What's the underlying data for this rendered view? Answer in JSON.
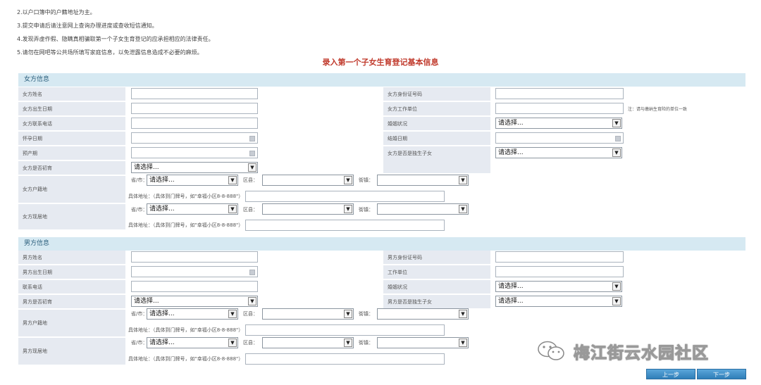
{
  "notes": [
    "2.以户口簿中的户籍地址为主。",
    "3.提交申请后请注意网上查询办理进度或查收短信通知。",
    "4.发现弄虚作假、隐瞒真相骗取第一个子女生育登记的应承担相应的法律责任。",
    "5.请勿在网吧等公共场所填写家庭信息，以免泄露信息造成不必要的麻烦。"
  ],
  "page_title": "录入第一个子女生育登记基本信息",
  "female": {
    "header": "女方信息",
    "name_label": "女方姓名",
    "id_label": "女方身份证号码",
    "birth_label": "女方出生日期",
    "work_label": "女方工作单位",
    "work_hint": "注：请与缴纳生育险的单位一致",
    "phone_label": "女方联系电话",
    "marital_label": "婚姻状况",
    "marital_value": "请选择...",
    "pregnancy_label": "怀孕日期",
    "marriage_label": "结婚日期",
    "due_label": "预产期",
    "only_child_label": "女方是否是独生子女",
    "only_child_value": "请选择...",
    "had_child_label": "女方是否初育",
    "had_child_value": "请选择...",
    "hukou_label": "女方户籍地",
    "residence_label": "女方现居地"
  },
  "male": {
    "header": "男方信息",
    "name_label": "男方姓名",
    "id_label": "男方身份证号码",
    "birth_label": "男方出生日期",
    "work_label": "工作单位",
    "phone_label": "联系电话",
    "marital_label": "婚姻状况",
    "marital_value": "请选择...",
    "had_child_label": "男方是否初育",
    "had_child_value": "请选择...",
    "only_child_label": "男方是否是独生子女",
    "only_child_value": "请选择...",
    "hukou_label": "男方户籍地",
    "residence_label": "男方现居地"
  },
  "address": {
    "province_label": "省/市：",
    "district_label": "区县：",
    "street_label": "街镇：",
    "detail_label": "具体地址：（具体到门牌号，如\"幸福小区8-8-888\"）",
    "select_value": "请选择..."
  },
  "watermark": "梅江街云水园社区",
  "buttons": {
    "prev": "上一步",
    "next": "下一步"
  },
  "colors": {
    "title": "#c0392b",
    "section_header_bg": "#d6e9f2",
    "label_bg": "#e6eaf1",
    "button": "#2f7eb8"
  }
}
